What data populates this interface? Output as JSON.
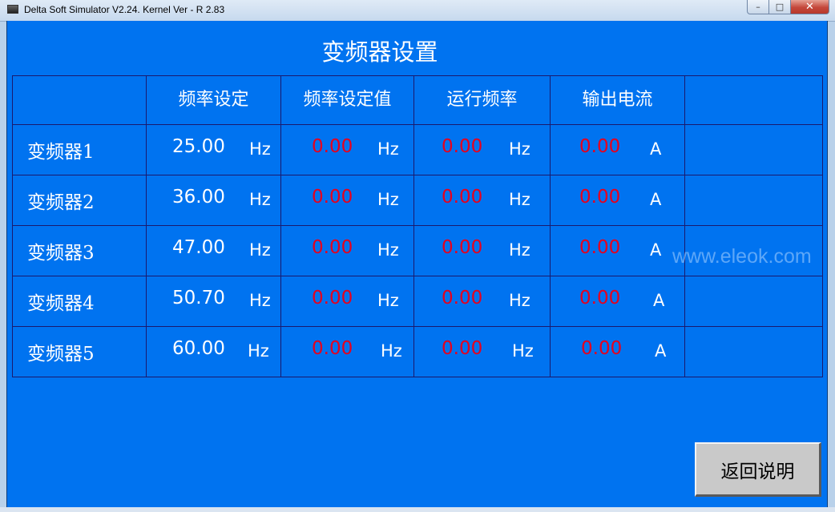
{
  "window": {
    "title": "Delta Soft Simulator V2.24. Kernel Ver - R 2.83",
    "minimize_glyph": "–",
    "maximize_glyph": "□",
    "close_glyph": "✕"
  },
  "page": {
    "title": "变频器设置",
    "watermark": "www.eleok.com",
    "return_label": "返回说明"
  },
  "table": {
    "headers": [
      "",
      "频率设定",
      "频率设定值",
      "运行频率",
      "输出电流",
      ""
    ],
    "rows": [
      {
        "label": "变频器1",
        "setpoint": "25.00",
        "setpoint_unit": "Hz",
        "set_value": "0.00",
        "set_value_unit": "Hz",
        "run_freq": "0.00",
        "run_freq_unit": "Hz",
        "current": "0.00",
        "current_unit": "A"
      },
      {
        "label": "变频器2",
        "setpoint": "36.00",
        "setpoint_unit": "Hz",
        "set_value": "0.00",
        "set_value_unit": "Hz",
        "run_freq": "0.00",
        "run_freq_unit": "Hz",
        "current": "0.00",
        "current_unit": "A"
      },
      {
        "label": "变频器3",
        "setpoint": "47.00",
        "setpoint_unit": "Hz",
        "set_value": "0.00",
        "set_value_unit": "Hz",
        "run_freq": "0.00",
        "run_freq_unit": "Hz",
        "current": "0.00",
        "current_unit": "A"
      },
      {
        "label": "变频器4",
        "setpoint": "50.70",
        "setpoint_unit": "Hz",
        "set_value": "0.00",
        "set_value_unit": "Hz",
        "run_freq": "0.00",
        "run_freq_unit": "Hz",
        "current": "0.00",
        "current_unit": "A"
      },
      {
        "label": "变频器5",
        "setpoint": "60.00",
        "setpoint_unit": "Hz",
        "set_value": "0.00",
        "set_value_unit": "Hz",
        "run_freq": "0.00",
        "run_freq_unit": "Hz",
        "current": "0.00",
        "current_unit": "A"
      }
    ]
  },
  "colors": {
    "screen_bg": "#0073f0",
    "grid_line": "#1a1a6e",
    "readout_red": "#e8001c",
    "text_white": "#ffffff",
    "button_gray": "#c9c9c9"
  }
}
